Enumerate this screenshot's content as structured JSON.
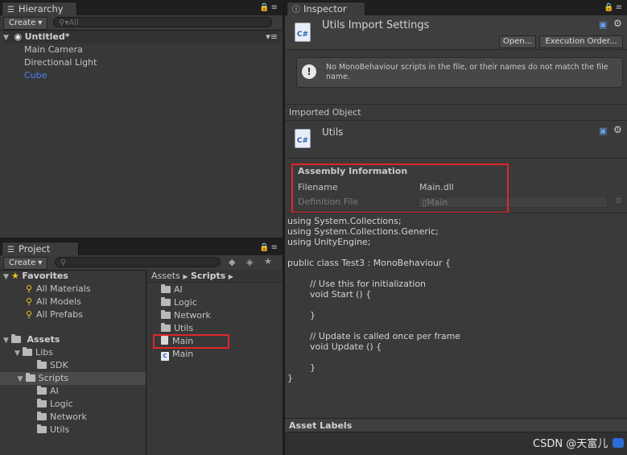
{
  "hierarchy": {
    "tab": "Hierarchy",
    "create": "Create",
    "search_placeholder": "All",
    "scene": "Untitled*",
    "items": [
      "Main Camera",
      "Directional Light",
      "Cube"
    ]
  },
  "project": {
    "tab": "Project",
    "create": "Create",
    "favorites": {
      "label": "Favorites",
      "items": [
        "All Materials",
        "All Models",
        "All Prefabs"
      ]
    },
    "assets": {
      "label": "Assets",
      "libs": "Libs",
      "sdk": "SDK",
      "scripts": "Scripts",
      "scripts_children": [
        "AI",
        "Logic",
        "Network",
        "Utils"
      ]
    },
    "breadcrumb": {
      "root": "Assets",
      "current": "Scripts"
    },
    "files": [
      "AI",
      "Logic",
      "Network",
      "Utils",
      "Main",
      "Main"
    ]
  },
  "inspector": {
    "tab": "Inspector",
    "title": "Utils Import Settings",
    "open_btn": "Open...",
    "exec_btn": "Execution Order...",
    "warning": "No MonoBehaviour scripts in the file, or their names do not match the file name.",
    "imported_header": "Imported Object",
    "imported_name": "Utils",
    "assembly_header": "Assembly Information",
    "filename_label": "Filename",
    "filename_value": "Main.dll",
    "deffile_label": "Definition File",
    "deffile_value": "Main",
    "code": "using System.Collections;\nusing System.Collections.Generic;\nusing UnityEngine;\n\npublic class Test3 : MonoBehaviour {\n\n\t// Use this for initialization\n\tvoid Start () {\n\t\t\n\t}\n\t\n\t// Update is called once per frame\n\tvoid Update () {\n\t\t\n\t}\n}",
    "asset_labels": "Asset Labels"
  },
  "watermark": "CSDN @天富儿",
  "colors": {
    "highlight_blue": "#4c7fff",
    "red_annotation": "#e0262b"
  }
}
